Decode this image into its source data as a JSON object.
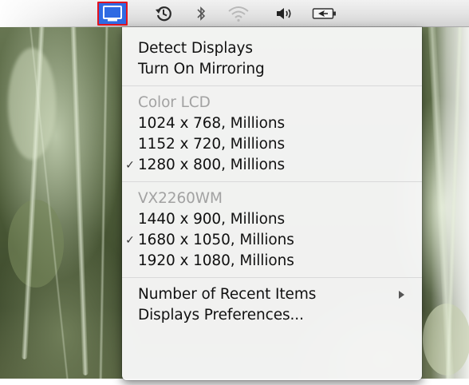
{
  "menubar": {
    "items": [
      {
        "icon": "display-icon",
        "selected": true
      },
      {
        "icon": "time-machine-icon"
      },
      {
        "icon": "bluetooth-icon"
      },
      {
        "icon": "wifi-icon"
      },
      {
        "icon": "volume-icon"
      },
      {
        "icon": "battery-icon"
      }
    ],
    "highlight_color": "#2f6ae3",
    "annotation_color": "#e3141f"
  },
  "menu": {
    "actions": {
      "detect_displays": "Detect Displays",
      "turn_on_mirroring": "Turn On Mirroring"
    },
    "display1": {
      "name": "Color LCD",
      "resolutions": [
        {
          "label": "1024 x 768, Millions",
          "checked": false
        },
        {
          "label": "1152 x 720, Millions",
          "checked": false
        },
        {
          "label": "1280 x 800, Millions",
          "checked": true
        }
      ]
    },
    "display2": {
      "name": "VX2260WM",
      "resolutions": [
        {
          "label": "1440 x 900, Millions",
          "checked": false
        },
        {
          "label": "1680 x 1050, Millions",
          "checked": true
        },
        {
          "label": "1920 x 1080, Millions",
          "checked": false
        }
      ]
    },
    "footer": {
      "recent_items": "Number of Recent Items",
      "preferences": "Displays Preferences..."
    },
    "checkmark": "✓"
  }
}
